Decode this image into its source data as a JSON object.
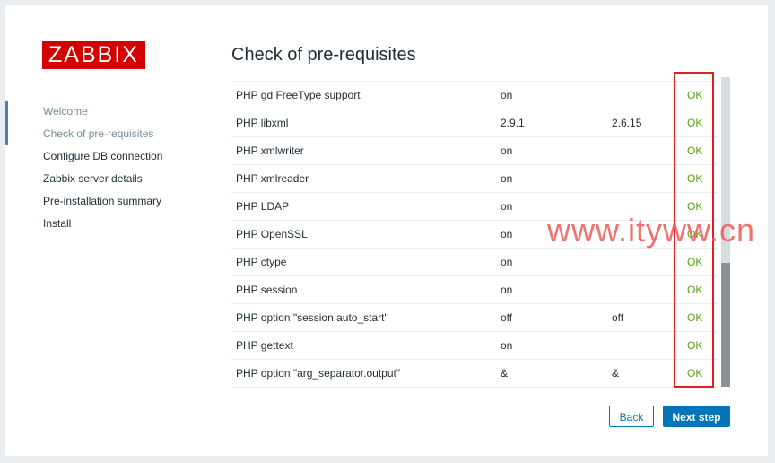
{
  "logo": "ZABBIX",
  "steps": [
    "Welcome",
    "Check of pre-requisites",
    "Configure DB connection",
    "Zabbix server details",
    "Pre-installation summary",
    "Install"
  ],
  "page_title": "Check of pre-requisites",
  "requirements": [
    {
      "name": "PHP gd FreeType support",
      "current": "on",
      "required": "",
      "result": "OK"
    },
    {
      "name": "PHP libxml",
      "current": "2.9.1",
      "required": "2.6.15",
      "result": "OK"
    },
    {
      "name": "PHP xmlwriter",
      "current": "on",
      "required": "",
      "result": "OK"
    },
    {
      "name": "PHP xmlreader",
      "current": "on",
      "required": "",
      "result": "OK"
    },
    {
      "name": "PHP LDAP",
      "current": "on",
      "required": "",
      "result": "OK"
    },
    {
      "name": "PHP OpenSSL",
      "current": "on",
      "required": "",
      "result": "OK"
    },
    {
      "name": "PHP ctype",
      "current": "on",
      "required": "",
      "result": "OK"
    },
    {
      "name": "PHP session",
      "current": "on",
      "required": "",
      "result": "OK"
    },
    {
      "name": "PHP option \"session.auto_start\"",
      "current": "off",
      "required": "off",
      "result": "OK"
    },
    {
      "name": "PHP gettext",
      "current": "on",
      "required": "",
      "result": "OK"
    },
    {
      "name": "PHP option \"arg_separator.output\"",
      "current": "&",
      "required": "&",
      "result": "OK"
    }
  ],
  "watermark": "www.ityww.cn",
  "buttons": {
    "back": "Back",
    "next": "Next step"
  },
  "colors": {
    "brand": "#d40000",
    "ok": "#59a10a",
    "primary": "#0275b8",
    "highlight": "#e02020"
  }
}
